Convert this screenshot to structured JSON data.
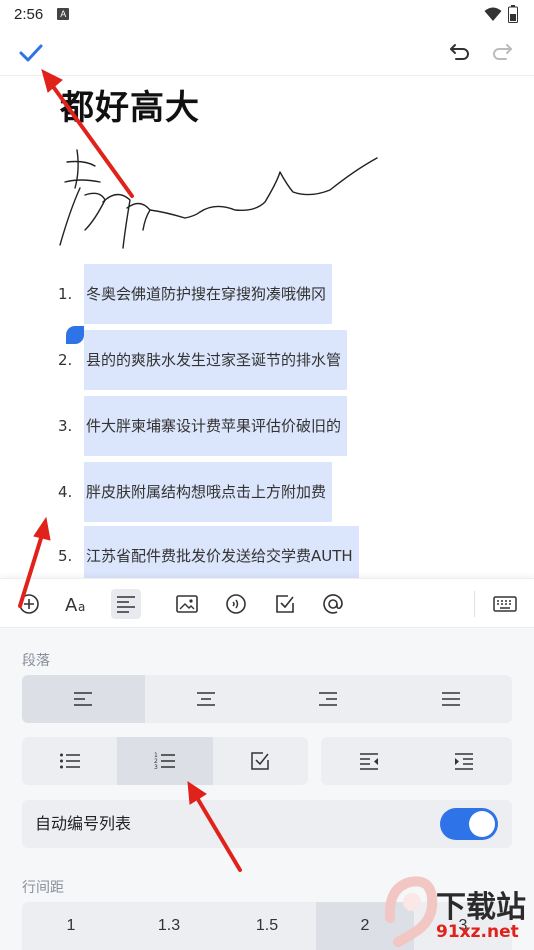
{
  "status": {
    "time": "2:56",
    "notification_badge": "A"
  },
  "toolbar": {
    "done_icon": "check-icon",
    "undo_icon": "undo-icon",
    "redo_icon": "redo-icon"
  },
  "document": {
    "title": "都好高大",
    "list": [
      {
        "num": "1.",
        "text": "冬奥会佛道防护搜在穿搜狗凑哦佛冈"
      },
      {
        "num": "2.",
        "text": "县的的爽肤水发生过家圣诞节的排水管"
      },
      {
        "num": "3.",
        "text": "件大胖柬埔寨设计费苹果评估价破旧的"
      },
      {
        "num": "4.",
        "text": "胖皮肤附属结构想哦点击上方附加费"
      },
      {
        "num": "5.",
        "text": "江苏省配件费批发价发送给交学费AUTH"
      }
    ]
  },
  "format_bar": {
    "icons": [
      "add-circle-icon",
      "font-size-icon",
      "paragraph-align-icon",
      "image-icon",
      "audio-icon",
      "checkbox-icon",
      "mention-icon",
      "keyboard-icon"
    ]
  },
  "panel": {
    "paragraph_label": "段落",
    "align_options": [
      "align-left",
      "align-center",
      "align-right",
      "align-justify"
    ],
    "list_options": [
      "bullet-list",
      "numbered-list",
      "checklist"
    ],
    "indent_options": [
      "outdent",
      "indent"
    ],
    "auto_number_label": "自动编号列表",
    "auto_number_enabled": true,
    "line_spacing_label": "行间距",
    "line_spacing_options": [
      "1",
      "1.3",
      "1.5",
      "2",
      "3"
    ],
    "line_spacing_selected": "2"
  },
  "watermark": {
    "brand": "下载站",
    "domain": "91xz.net"
  },
  "colors": {
    "accent": "#2f73e8",
    "selection": "#dbe5fb",
    "annotation_arrow": "#e0221b"
  }
}
